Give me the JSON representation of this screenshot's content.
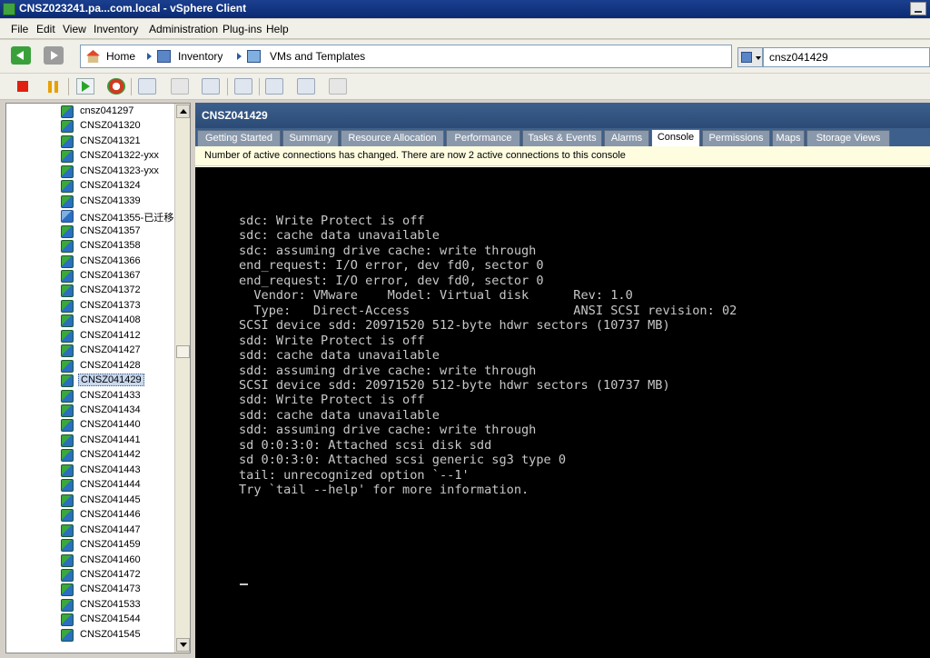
{
  "window": {
    "title": "CNSZ023241.pa...com.local - vSphere Client"
  },
  "menu": [
    "File",
    "Edit",
    "View",
    "Inventory",
    "Administration",
    "Plug-ins",
    "Help"
  ],
  "breadcrumb": {
    "home": "Home",
    "inventory": "Inventory",
    "vms": "VMs and Templates"
  },
  "search": {
    "value": "cnsz041429"
  },
  "tree": {
    "items": [
      "cnsz041297",
      "CNSZ041320",
      "CNSZ041321",
      "CNSZ041322-yxx",
      "CNSZ041323-yxx",
      "CNSZ041324",
      "CNSZ041339",
      "CNSZ041355-已迁移",
      "CNSZ041357",
      "CNSZ041358",
      "CNSZ041366",
      "CNSZ041367",
      "CNSZ041372",
      "CNSZ041373",
      "CNSZ041408",
      "CNSZ041412",
      "CNSZ041427",
      "CNSZ041428",
      "CNSZ041429",
      "CNSZ041433",
      "CNSZ041434",
      "CNSZ041440",
      "CNSZ041441",
      "CNSZ041442",
      "CNSZ041443",
      "CNSZ041444",
      "CNSZ041445",
      "CNSZ041446",
      "CNSZ041447",
      "CNSZ041459",
      "CNSZ041460",
      "CNSZ041472",
      "CNSZ041473",
      "CNSZ041533",
      "CNSZ041544",
      "CNSZ041545"
    ],
    "selected": "CNSZ041429"
  },
  "vm": {
    "title": "CNSZ041429"
  },
  "tabs": [
    "Getting Started",
    "Summary",
    "Resource Allocation",
    "Performance",
    "Tasks & Events",
    "Alarms",
    "Console",
    "Permissions",
    "Maps",
    "Storage Views"
  ],
  "active_tab": "Console",
  "notification": "Number of active connections has changed. There are now 2 active connections to this console",
  "console_lines": [
    "sdc: Write Protect is off",
    "sdc: cache data unavailable",
    "sdc: assuming drive cache: write through",
    "end_request: I/O error, dev fd0, sector 0",
    "end_request: I/O error, dev fd0, sector 0",
    "  Vendor: VMware    Model: Virtual disk      Rev: 1.0",
    "  Type:   Direct-Access                      ANSI SCSI revision: 02",
    "SCSI device sdd: 20971520 512-byte hdwr sectors (10737 MB)",
    "sdd: Write Protect is off",
    "sdd: cache data unavailable",
    "sdd: assuming drive cache: write through",
    "SCSI device sdd: 20971520 512-byte hdwr sectors (10737 MB)",
    "sdd: Write Protect is off",
    "sdd: cache data unavailable",
    "sdd: assuming drive cache: write through",
    "sd 0:0:3:0: Attached scsi disk sdd",
    "sd 0:0:3:0: Attached scsi generic sg3 type 0",
    "tail: unrecognized option `--1'",
    "Try `tail --help' for more information."
  ]
}
